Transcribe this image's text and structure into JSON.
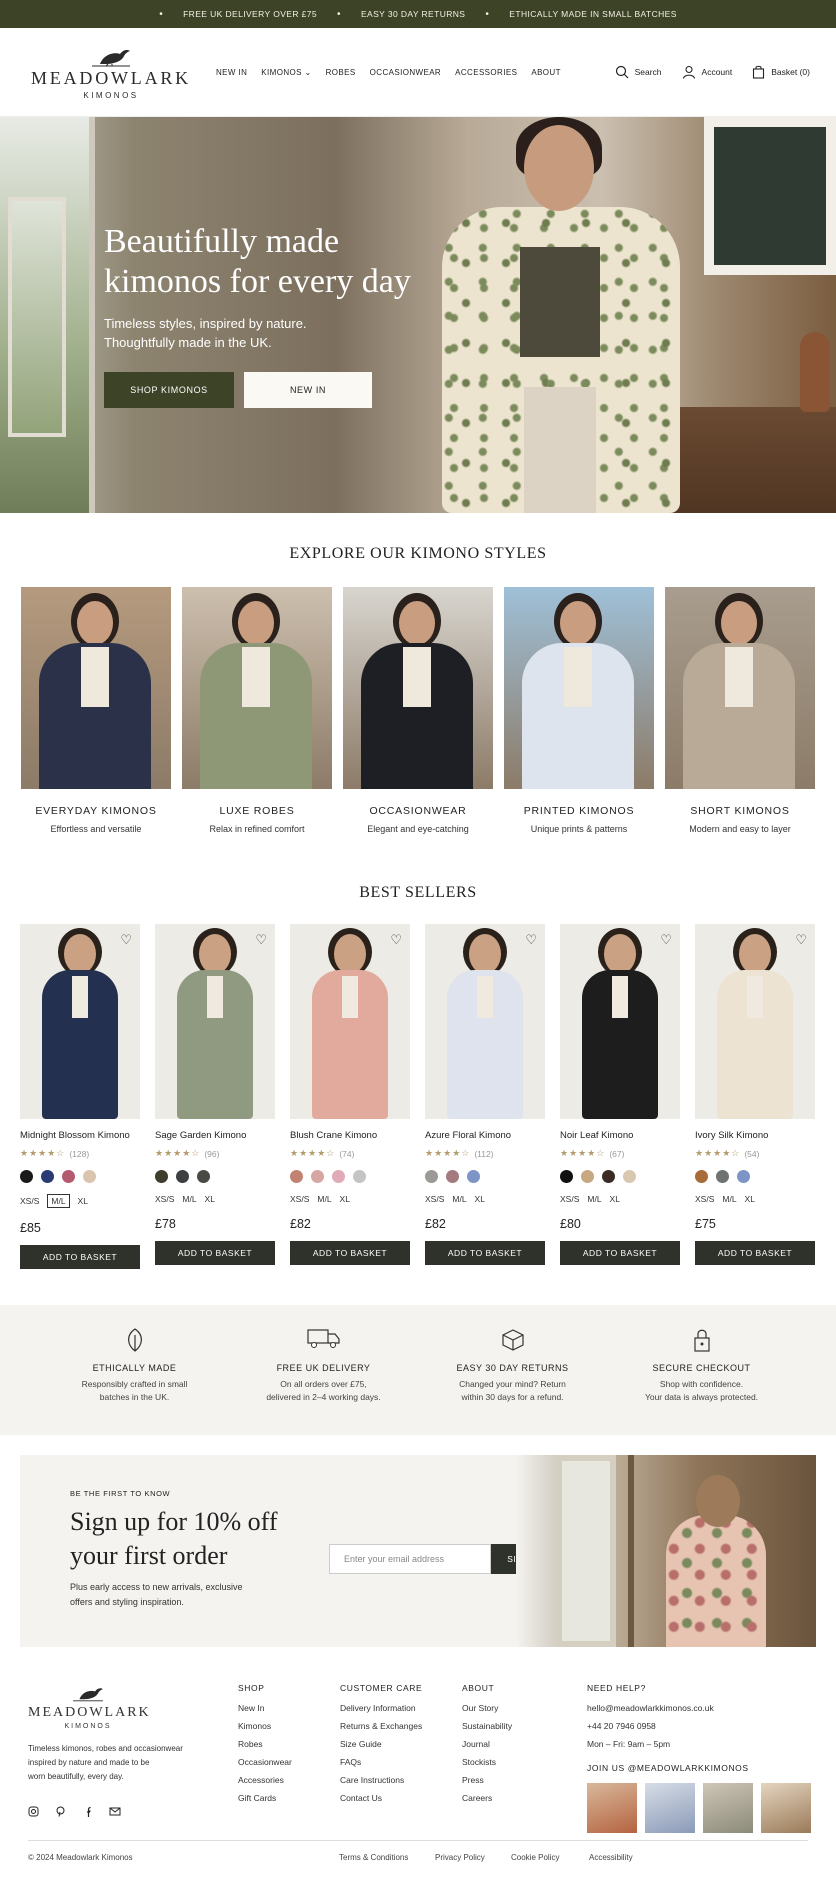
{
  "announcement": {
    "items": [
      "FREE UK DELIVERY OVER £75",
      "EASY 30 DAY RETURNS",
      "ETHICALLY MADE IN SMALL BATCHES"
    ]
  },
  "header": {
    "logo_name": "MEADOWLARK",
    "logo_sub": "KIMONOS",
    "nav": [
      "NEW IN",
      "KIMONOS",
      "ROBES",
      "OCCASIONWEAR",
      "ACCESSORIES",
      "ABOUT"
    ],
    "search": "Search",
    "account": "Account",
    "basket": "Basket (0)"
  },
  "hero": {
    "title_line1": "Beautifully made",
    "title_line2": "kimonos for every day",
    "sub_line1": "Timeless styles, inspired by nature.",
    "sub_line2": "Thoughtfully made in the UK.",
    "btn_primary": "SHOP KIMONOS",
    "btn_secondary": "NEW IN"
  },
  "styles": {
    "title": "EXPLORE OUR KIMONO STYLES",
    "items": [
      {
        "name": "EVERYDAY KIMONOS",
        "desc": "Effortless and versatile",
        "bg": "#b59a7e",
        "robe": "#2a3148"
      },
      {
        "name": "LUXE ROBES",
        "desc": "Relax in refined comfort",
        "bg": "#cdbfae",
        "robe": "#8e9876"
      },
      {
        "name": "OCCASIONWEAR",
        "desc": "Elegant and eye-catching",
        "bg": "#d8d5cf",
        "robe": "#1e1f25"
      },
      {
        "name": "PRINTED KIMONOS",
        "desc": "Unique prints & patterns",
        "bg": "#9fc0d8",
        "robe": "#dde4ee"
      },
      {
        "name": "SHORT KIMONOS",
        "desc": "Modern and easy to layer",
        "bg": "#a89d8e",
        "robe": "#b8aa96"
      }
    ]
  },
  "bestsellers": {
    "title": "BEST SELLERS",
    "add_label": "ADD TO BASKET",
    "products": [
      {
        "name": "Midnight Blossom Kimono",
        "rating": 4,
        "reviews": "(128)",
        "swatches": [
          "#1a1a1a",
          "#2a3a74",
          "#b45a6e",
          "#d9c4ad"
        ],
        "sizes": [
          "XS/S",
          "M/L",
          "XL"
        ],
        "selected": 1,
        "price": "£85",
        "robe": "#24304f"
      },
      {
        "name": "Sage Garden Kimono",
        "rating": 4,
        "reviews": "(96)",
        "swatches": [
          "#3f3d2c",
          "#3d3f41",
          "#4a4a44"
        ],
        "sizes": [
          "XS/S",
          "M/L",
          "XL"
        ],
        "selected": -1,
        "price": "£78",
        "robe": "#8f9a80"
      },
      {
        "name": "Blush Crane Kimono",
        "rating": 4,
        "reviews": "(74)",
        "swatches": [
          "#c28272",
          "#d5a6a2",
          "#e0aab8",
          "#c4c4c4"
        ],
        "sizes": [
          "XS/S",
          "M/L",
          "XL"
        ],
        "selected": -1,
        "price": "£82",
        "robe": "#e2aa9c"
      },
      {
        "name": "Azure Floral Kimono",
        "rating": 4,
        "reviews": "(112)",
        "swatches": [
          "#9c9a96",
          "#a47a7e",
          "#7d94c6"
        ],
        "sizes": [
          "XS/S",
          "M/L",
          "XL"
        ],
        "selected": -1,
        "price": "£82",
        "robe": "#dfe3ee"
      },
      {
        "name": "Noir Leaf Kimono",
        "rating": 4,
        "reviews": "(67)",
        "swatches": [
          "#111111",
          "#c8a883",
          "#3a2c24",
          "#d8c8b0"
        ],
        "sizes": [
          "XS/S",
          "M/L",
          "XL"
        ],
        "selected": -1,
        "price": "£80",
        "robe": "#1d1d1d"
      },
      {
        "name": "Ivory Silk Kimono",
        "rating": 4,
        "reviews": "(54)",
        "swatches": [
          "#a86c3a",
          "#6f7370",
          "#7d94c6"
        ],
        "sizes": [
          "XS/S",
          "M/L",
          "XL"
        ],
        "selected": -1,
        "price": "£75",
        "robe": "#ede3d2"
      }
    ]
  },
  "features": [
    {
      "icon": "leaf-icon",
      "title": "ETHICALLY MADE",
      "line1": "Responsibly crafted in small",
      "line2": "batches in the UK."
    },
    {
      "icon": "truck-icon",
      "title": "FREE UK DELIVERY",
      "line1": "On all orders over £75,",
      "line2": "delivered in 2–4 working days."
    },
    {
      "icon": "return-box-icon",
      "title": "EASY 30 DAY RETURNS",
      "line1": "Changed your mind? Return",
      "line2": "within 30 days for a refund."
    },
    {
      "icon": "lock-icon",
      "title": "SECURE CHECKOUT",
      "line1": "Shop with confidence.",
      "line2": "Your data is always protected."
    }
  ],
  "signup": {
    "eyebrow": "BE THE FIRST TO KNOW",
    "title_line1": "Sign up for 10% off",
    "title_line2": "your first order",
    "text_line1": "Plus early access to new arrivals, exclusive",
    "text_line2": "offers and styling inspiration.",
    "placeholder": "Enter your email address",
    "button": "SIGN UP"
  },
  "footer": {
    "logo_name": "MEADOWLARK",
    "logo_sub": "KIMONOS",
    "blurb_line1": "Timeless kimonos, robes and occasionwear",
    "blurb_line2": "inspired by nature and made to be",
    "blurb_line3": "worn beautifully, every day.",
    "shop": {
      "title": "SHOP",
      "links": [
        "New In",
        "Kimonos",
        "Robes",
        "Occasionwear",
        "Accessories",
        "Gift Cards"
      ]
    },
    "care": {
      "title": "CUSTOMER CARE",
      "links": [
        "Delivery Information",
        "Returns & Exchanges",
        "Size Guide",
        "FAQs",
        "Care Instructions",
        "Contact Us"
      ]
    },
    "about": {
      "title": "ABOUT",
      "links": [
        "Our Story",
        "Sustainability",
        "Journal",
        "Stockists",
        "Press",
        "Careers"
      ]
    },
    "help": {
      "title": "NEED HELP?",
      "email": "hello@meadowlarkkimonos.co.uk",
      "phone": "+44 20 7946 0958",
      "hours": "Mon – Fri: 9am – 5pm"
    },
    "instagram_title": "JOIN US @MEADOWLARKKIMONOS",
    "copyright": "© 2024 Meadowlark Kimonos",
    "legal": [
      "Terms & Conditions",
      "Privacy Policy",
      "Cookie Policy",
      "Accessibility"
    ]
  }
}
